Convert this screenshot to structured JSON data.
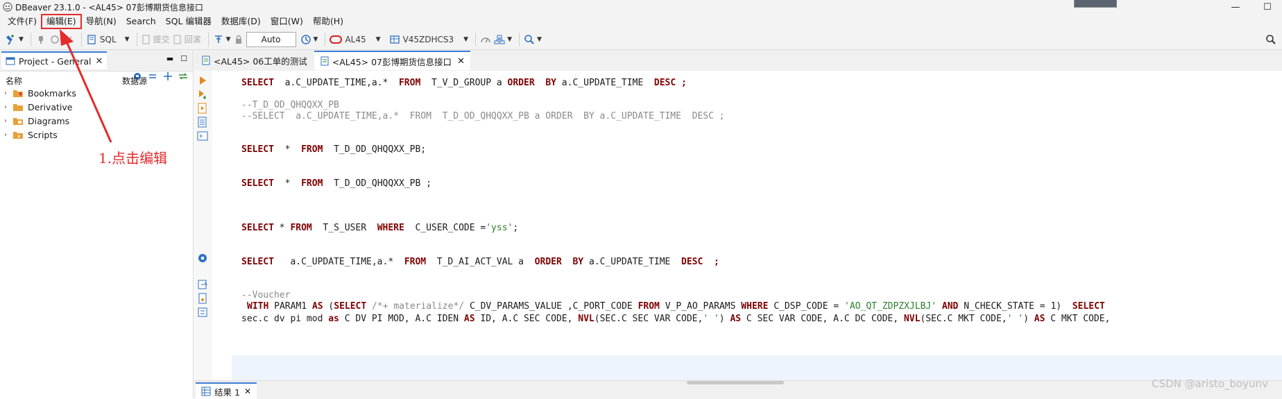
{
  "window": {
    "title": "DBeaver 23.1.0 - <AL45> 07彭博期货信息接口",
    "minimize_glyph": "—",
    "maximize_glyph": "☐"
  },
  "menu": {
    "items": [
      "文件(F)",
      "编辑(E)",
      "导航(N)",
      "Search",
      "SQL 编辑器",
      "数据库(D)",
      "窗口(W)",
      "帮助(H)"
    ]
  },
  "toolbar": {
    "sql_label": "SQL",
    "commit_label": "提交",
    "rollback_label": "回滚",
    "transaction_mode": "Auto",
    "datasource": "AL45",
    "schema": "V45ZDHCS3"
  },
  "left_panel": {
    "tab_label": "Project - General",
    "column_name": "名称",
    "column_datasource": "数据源",
    "tree": [
      "Bookmarks",
      "Derivative",
      "Diagrams",
      "Scripts"
    ]
  },
  "editor_tabs": [
    {
      "label": "<AL45> 06工单的测试",
      "active": false
    },
    {
      "label": "<AL45> 07彭博期货信息接口",
      "active": true
    }
  ],
  "code": {
    "line1": {
      "kw1": "SELECT",
      "t1": "  a.C_UPDATE_TIME,a.*  ",
      "kw2": "FROM",
      "t2": "  T_V_D_GROUP a ",
      "kw3": "ORDER",
      "t3": "  ",
      "kw4": "BY",
      "t4": " a.C_UPDATE_TIME  ",
      "kw5": "DESC",
      "t5": " ;"
    },
    "comment1": "--T_D_OD_QHQQXX_PB",
    "comment2": "--SELECT  a.C_UPDATE_TIME,a.*  FROM  T_D_OD_QHQQXX_PB a ORDER  BY a.C_UPDATE_TIME  DESC ;",
    "line3": {
      "kw1": "SELECT",
      "t1": "  *  ",
      "kw2": "FROM",
      "t2": "  T_D_OD_QHQQXX_PB;"
    },
    "line4": {
      "kw1": "SELECT",
      "t1": "  *  ",
      "kw2": "FROM",
      "t2": "  T_D_OD_QHQQXX_PB ;"
    },
    "line5": {
      "kw1": "SELECT",
      "t1": " * ",
      "kw2": "FROM",
      "t2": "  T_S_USER  ",
      "kw3": "WHERE",
      "t3": "  C_USER_CODE =",
      "str": "'yss'",
      "t4": ";"
    },
    "line6": {
      "kw1": "SELECT",
      "t1": "   a.C_UPDATE_TIME,a.*  ",
      "kw2": "FROM",
      "t2": "  T_D_AI_ACT_VAL a  ",
      "kw3": "ORDER",
      "t3": "  ",
      "kw4": "BY",
      "t4": " a.C_UPDATE_TIME  ",
      "kw5": "DESC",
      "t5": "  ;"
    },
    "comment3": "--Voucher",
    "line8": {
      "kw1": "WITH",
      "t1": " PARAM1 ",
      "kw2": "AS",
      "t2": " (",
      "kw3": "SELECT",
      "cm": " /*+ materialize*/ ",
      "t3": "C_DV_PARAMS_VALUE ,C_PORT_CODE ",
      "kw4": "FROM",
      "t4": " V_P_AO_PARAMS ",
      "kw5": "WHERE",
      "t5": " C_DSP_CODE = ",
      "str": "'AO_QT_ZDPZXJLBJ'",
      "t6": " ",
      "kw6": "AND",
      "t7": " N_CHECK_STATE = 1)  ",
      "kw7": "SELECT"
    },
    "line9": {
      "t1": "sec.c dv pi mod ",
      "kw1": "as",
      "t2": " C DV PI MOD, A.C IDEN ",
      "kw2": "AS",
      "t3": " ID, A.C SEC CODE, ",
      "kw3": "NVL",
      "t4": "(SEC.C SEC VAR CODE,",
      "str1": "' '",
      "t5": ") ",
      "kw4": "AS",
      "t6": " C SEC VAR CODE, A.C DC CODE, ",
      "kw5": "NVL",
      "t7": "(SEC.C MKT CODE,",
      "str2": "' '",
      "t8": ") ",
      "kw6": "AS",
      "t9": " C MKT CODE,"
    }
  },
  "result_tab": "结果 1",
  "annotation": "1.点击编辑",
  "watermark": "CSDN @aristo_boyunv",
  "colors": {
    "keyword": "#7f0000",
    "comment": "#8a8a8a",
    "string": "#2a7d2a",
    "annotation": "#e32b2b",
    "tab_accent": "#3c7bd3"
  }
}
